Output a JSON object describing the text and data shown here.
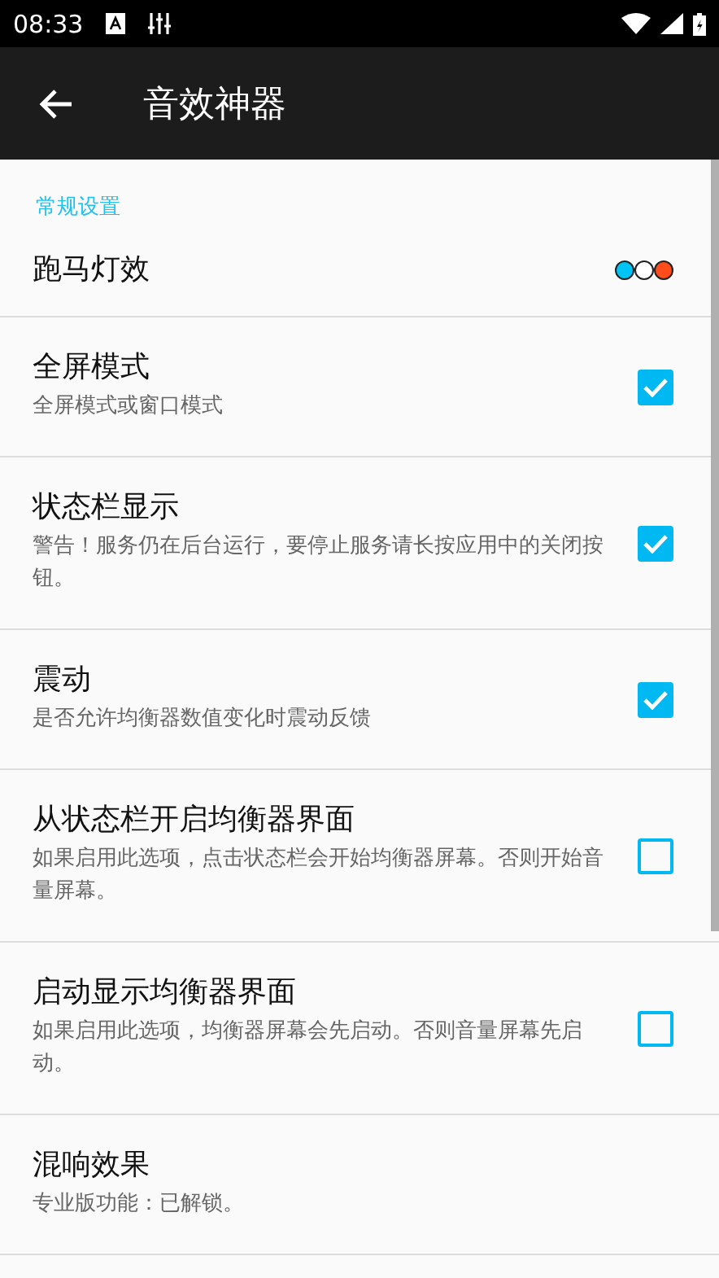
{
  "status_bar": {
    "time": "08:33"
  },
  "app_bar": {
    "title": "音效神器"
  },
  "category": "常规设置",
  "items": [
    {
      "kind": "dots",
      "title": "跑马灯效",
      "dots": [
        {
          "color": "#00c4f4"
        },
        {
          "color": "#ffffff"
        },
        {
          "color": "#ff4c1c"
        }
      ]
    },
    {
      "kind": "checkbox",
      "title": "全屏模式",
      "summary": "全屏模式或窗口模式",
      "checked": true
    },
    {
      "kind": "checkbox",
      "title": "状态栏显示",
      "summary": "警告！服务仍在后台运行，要停止服务请长按应用中的关闭按钮。",
      "checked": true
    },
    {
      "kind": "checkbox",
      "title": "震动",
      "summary": "是否允许均衡器数值变化时震动反馈",
      "checked": true
    },
    {
      "kind": "checkbox",
      "title": "从状态栏开启均衡器界面",
      "summary": "如果启用此选项，点击状态栏会开始均衡器屏幕。否则开始音量屏幕。",
      "checked": false
    },
    {
      "kind": "checkbox",
      "title": "启动显示均衡器界面",
      "summary": "如果启用此选项，均衡器屏幕会先启动。否则音量屏幕先启动。",
      "checked": false
    },
    {
      "kind": "plain",
      "title": "混响效果",
      "summary": "专业版功能：已解锁。"
    }
  ]
}
